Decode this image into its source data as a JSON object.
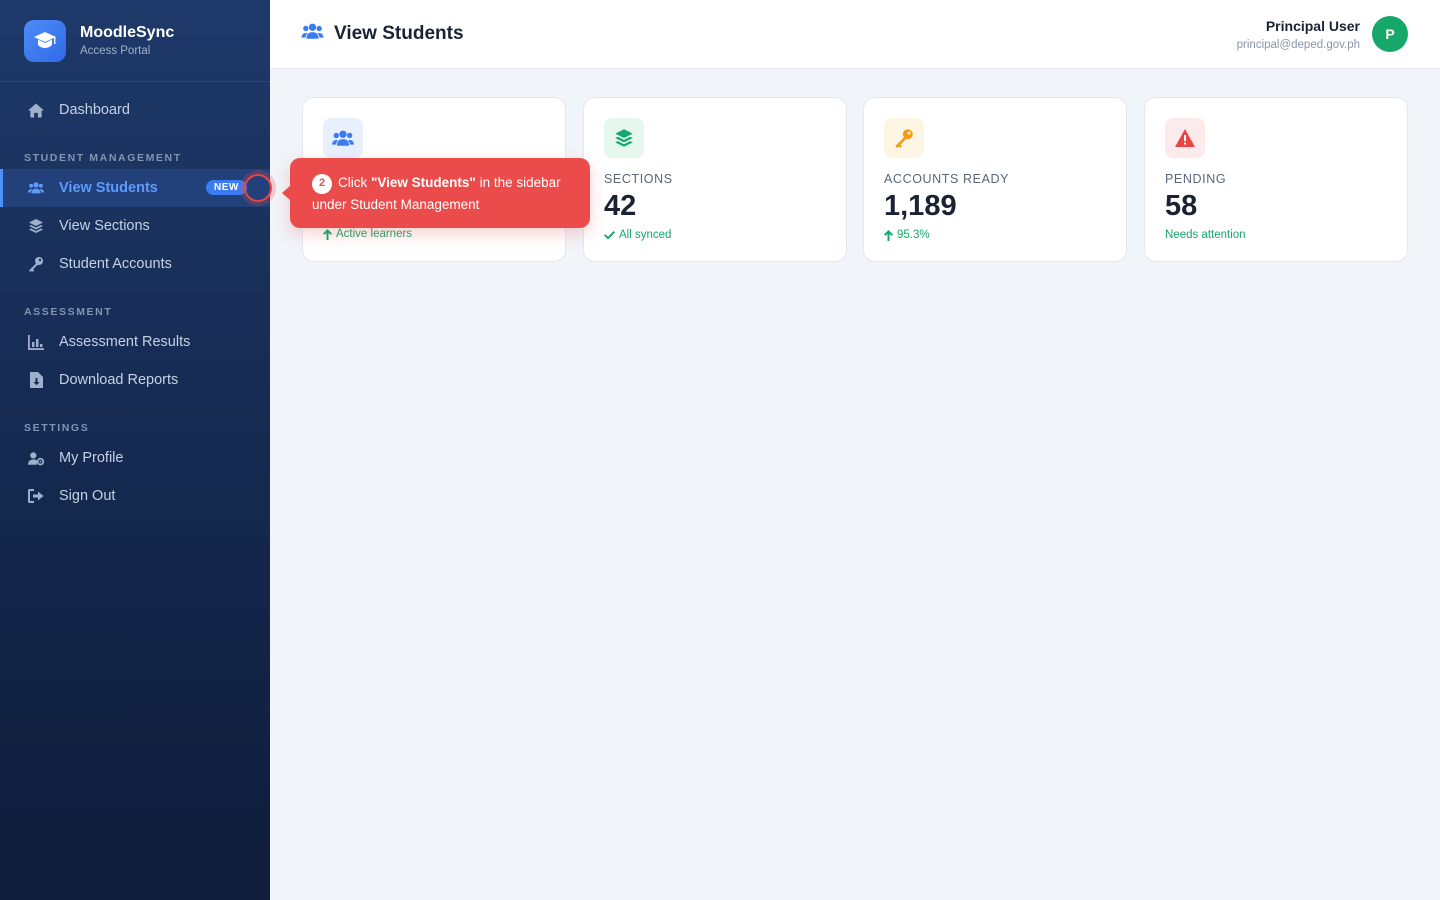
{
  "brand": {
    "title": "MoodleSync",
    "subtitle": "Access Portal"
  },
  "sidebar": {
    "dashboard": "Dashboard",
    "sections": [
      {
        "label": "STUDENT MANAGEMENT",
        "items": [
          {
            "label": "View Students",
            "icon": "users-icon",
            "active": true,
            "badge": "NEW"
          },
          {
            "label": "View Sections",
            "icon": "layers-icon"
          },
          {
            "label": "Student Accounts",
            "icon": "key-icon"
          }
        ]
      },
      {
        "label": "ASSESSMENT",
        "items": [
          {
            "label": "Assessment Results",
            "icon": "bar-chart-icon"
          },
          {
            "label": "Download Reports",
            "icon": "file-download-icon"
          }
        ]
      },
      {
        "label": "SETTINGS",
        "items": [
          {
            "label": "My Profile",
            "icon": "user-cog-icon"
          },
          {
            "label": "Sign Out",
            "icon": "sign-out-icon"
          }
        ]
      }
    ]
  },
  "header": {
    "title": "View Students",
    "user_name": "Principal User",
    "user_email": "principal@deped.gov.ph",
    "avatar_initial": "P"
  },
  "cards": [
    {
      "label": "",
      "value": "",
      "sub": "Active learners",
      "icon": "users-icon",
      "color": "#3b7cf2"
    },
    {
      "label": "SECTIONS",
      "value": "42",
      "sub": "All synced",
      "icon": "layers-icon",
      "color": "#15a86a"
    },
    {
      "label": "ACCOUNTS READY",
      "value": "1,189",
      "sub": "95.3%",
      "icon": "key-icon",
      "color": "#f39c12"
    },
    {
      "label": "PENDING",
      "value": "58",
      "sub": "Needs attention",
      "icon": "alert-icon",
      "color": "#e84545"
    }
  ],
  "tooltip": {
    "step": "2",
    "prefix": "Click ",
    "highlight": "\"View Students\"",
    "suffix": " in the sidebar under Student Management"
  },
  "colors": {
    "accent": "#3b7cf2",
    "success": "#15a86a",
    "danger": "#ec4b4b"
  }
}
